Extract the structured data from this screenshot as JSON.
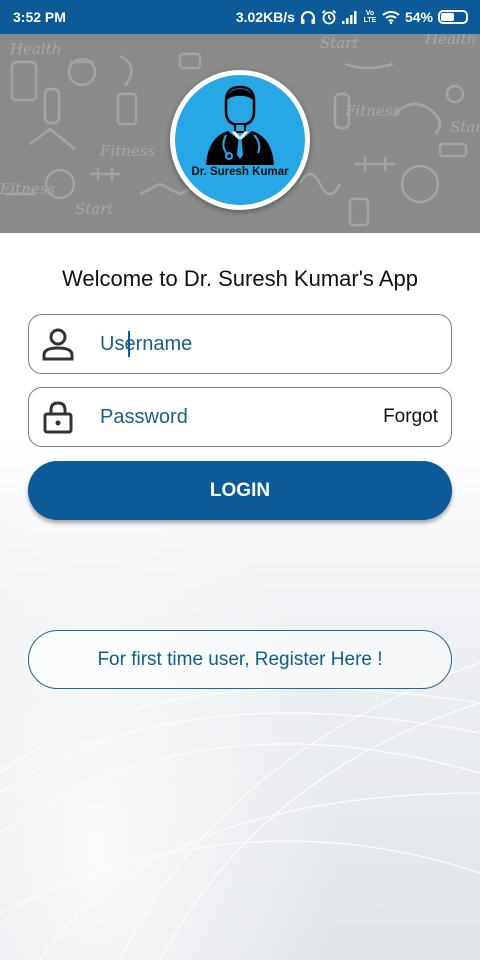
{
  "status_bar": {
    "time": "3:52 PM",
    "network_speed": "3.02KB/s",
    "volte_label_top": "Vo",
    "volte_label_bottom": "LTE",
    "battery_percent": "54%",
    "battery_level": 0.54,
    "icons": [
      "headphones-icon",
      "alarm-icon",
      "signal-icon",
      "volte-icon",
      "wifi-icon",
      "battery-icon"
    ]
  },
  "header": {
    "background_color": "#8a8a8a",
    "logo_color": "#27a7e6",
    "logo_label": "Dr. Suresh Kumar",
    "pattern_words": [
      "Health",
      "Fitness",
      "Start",
      "Fitness",
      "Health",
      "Fitness",
      "Start",
      "Start"
    ]
  },
  "login": {
    "welcome_text": "Welcome to Dr. Suresh Kumar's App",
    "username_placeholder": "Username",
    "password_placeholder": "Password",
    "forgot_label": "Forgot",
    "login_button_label": "LOGIN",
    "register_button_label": "For first time user, Register Here !"
  },
  "colors": {
    "primary": "#0c5a97",
    "accent_text": "#0f5f86"
  }
}
